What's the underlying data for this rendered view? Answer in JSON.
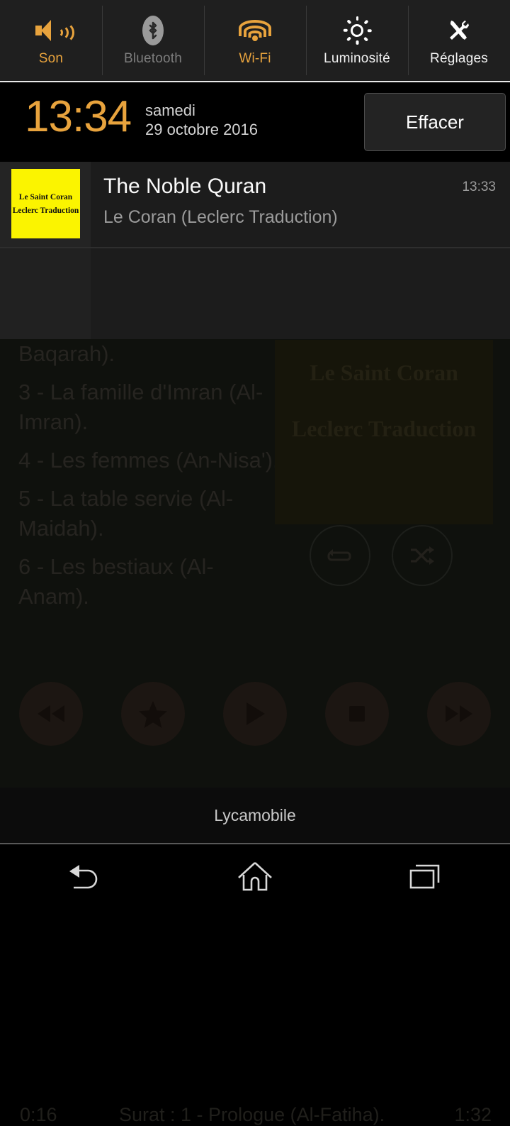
{
  "quick_settings": {
    "tiles": [
      {
        "label": "Son",
        "icon": "volume-icon",
        "state": "on"
      },
      {
        "label": "Bluetooth",
        "icon": "bluetooth-icon",
        "state": "off"
      },
      {
        "label": "Wi-Fi",
        "icon": "wifi-icon",
        "state": "on"
      },
      {
        "label": "Luminosité",
        "icon": "brightness-icon",
        "state": "plain"
      },
      {
        "label": "Réglages",
        "icon": "settings-tools-icon",
        "state": "plain"
      }
    ],
    "accent_color": "#e8a33d",
    "disabled_color": "#7d7d7d"
  },
  "status": {
    "time": "13:34",
    "day": "samedi",
    "date": "29 octobre 2016",
    "clear_button": "Effacer"
  },
  "notification": {
    "app_title": "The Noble Quran",
    "subtitle": "Le Coran (Leclerc Traduction)",
    "time": "13:33",
    "album_art_line1": "Le Saint Coran",
    "album_art_line2": "Leclerc Traduction",
    "album_art_color": "#fbf400"
  },
  "background_app": {
    "surah_items": [
      "Baqarah).",
      "3 - La famille d'Imran (Al-Imran).",
      "4 - Les femmes (An-Nisa').",
      "5 - La table servie (Al-Maidah).",
      "6 - Les bestiaux (Al-Anam)."
    ],
    "album_art_line1": "Le Saint Coran",
    "album_art_line2": "Leclerc Traduction",
    "mode_buttons": [
      {
        "name": "repeat-icon"
      },
      {
        "name": "shuffle-icon"
      }
    ],
    "transport_buttons": [
      {
        "name": "rewind-icon"
      },
      {
        "name": "favorite-star-icon"
      },
      {
        "name": "play-icon"
      },
      {
        "name": "stop-icon"
      },
      {
        "name": "fast-forward-icon"
      }
    ],
    "elapsed_time": "0:16",
    "track_label": "Surat : 1 - Prologue (Al-Fatiha).",
    "total_time": "1:32"
  },
  "carrier": {
    "name": "Lycamobile"
  },
  "navbar": {
    "buttons": [
      {
        "name": "back-icon"
      },
      {
        "name": "home-icon"
      },
      {
        "name": "recents-icon"
      }
    ]
  }
}
